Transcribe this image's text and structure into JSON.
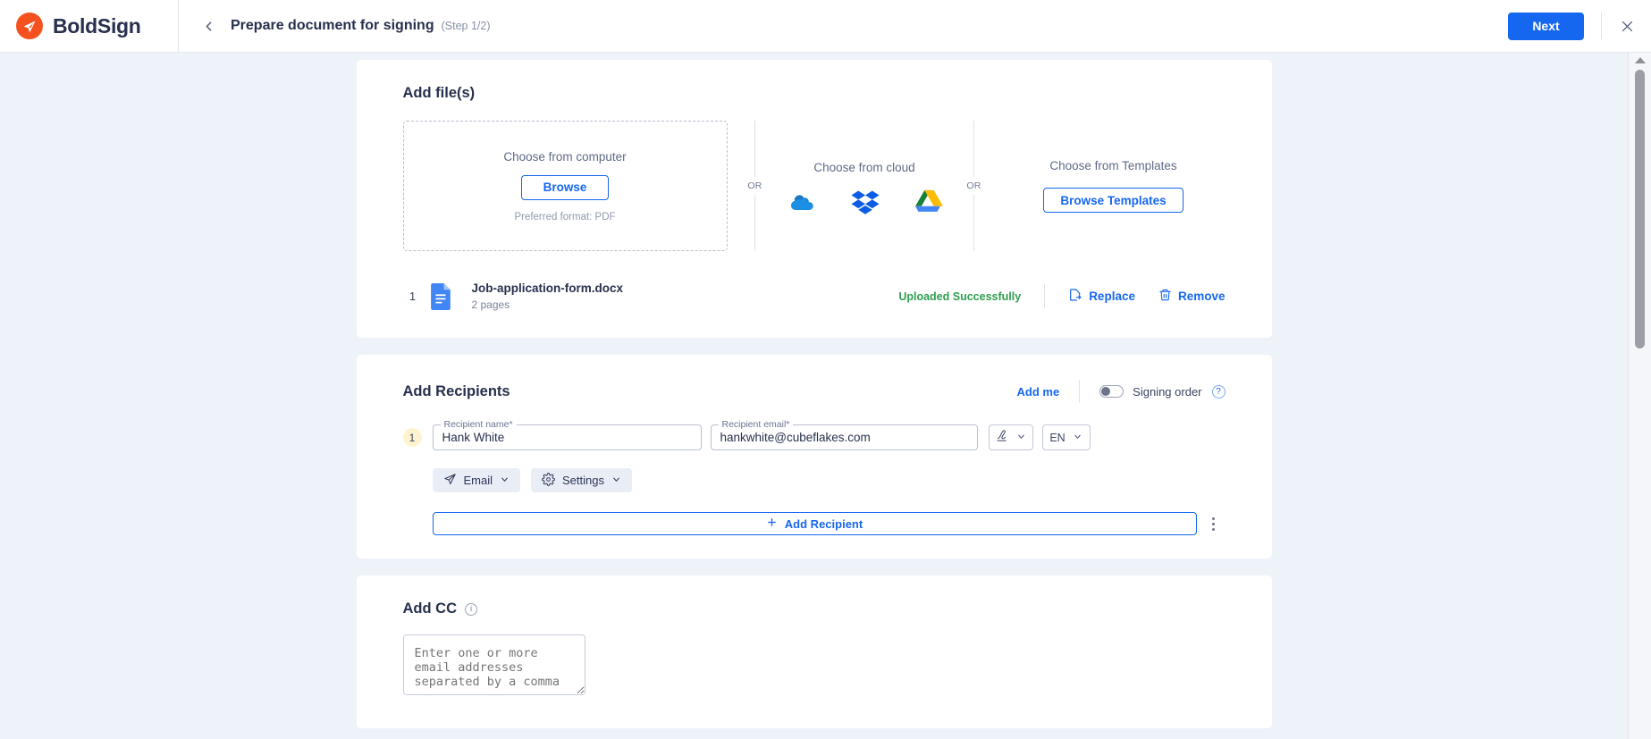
{
  "header": {
    "brand_name": "BoldSign",
    "brand_icon": "paper-plane-logo-icon",
    "back_icon": "chevron-left-icon",
    "title": "Prepare document for signing",
    "step": "(Step 1/2)",
    "next_label": "Next",
    "close_icon": "close-icon",
    "accent_color": "#1667f0",
    "brand_color": "#f4511e"
  },
  "add_files": {
    "title": "Add file(s)",
    "computer": {
      "label": "Choose from computer",
      "browse_label": "Browse",
      "hint": "Preferred format: PDF"
    },
    "or_left": "OR",
    "or_right": "OR",
    "cloud": {
      "label": "Choose from cloud",
      "providers": [
        {
          "name": "onedrive-icon",
          "color": "#1a73c8"
        },
        {
          "name": "dropbox-icon",
          "color": "#0d5ce6"
        },
        {
          "name": "google-drive-icon",
          "color": "#f6b825"
        }
      ]
    },
    "templates": {
      "label": "Choose from Templates",
      "browse_label": "Browse Templates"
    },
    "uploaded_file": {
      "index": "1",
      "icon": "document-file-icon",
      "name": "Job-application-form.docx",
      "pages": "2 pages",
      "status": "Uploaded Successfully",
      "status_color": "#2e9e4f",
      "replace_label": "Replace",
      "replace_icon": "replace-document-icon",
      "remove_label": "Remove",
      "remove_icon": "trash-icon"
    }
  },
  "recipients": {
    "title": "Add Recipients",
    "add_me_label": "Add me",
    "signing_order_label": "Signing order",
    "signing_order_enabled": false,
    "help_icon_glyph": "?",
    "rows": [
      {
        "badge": "1",
        "name_legend": "Recipient name*",
        "name_value": "Hank White",
        "email_legend": "Recipient email*",
        "email_value": "hankwhite@cubeflakes.com",
        "signature_type_icon": "signature-pen-icon",
        "language": "EN"
      }
    ],
    "email_pill": {
      "label": "Email",
      "icon": "paper-plane-icon"
    },
    "settings_pill": {
      "label": "Settings",
      "icon": "gear-icon"
    },
    "add_recipient_label": "Add Recipient",
    "add_recipient_icon": "plus-icon",
    "more_icon": "kebab-menu-icon"
  },
  "cc": {
    "title": "Add CC",
    "info_icon_glyph": "i",
    "placeholder": "Enter one or more email addresses separated by a comma",
    "value": ""
  },
  "scrollbar": {
    "up_arrow_icon": "caret-up-icon"
  }
}
